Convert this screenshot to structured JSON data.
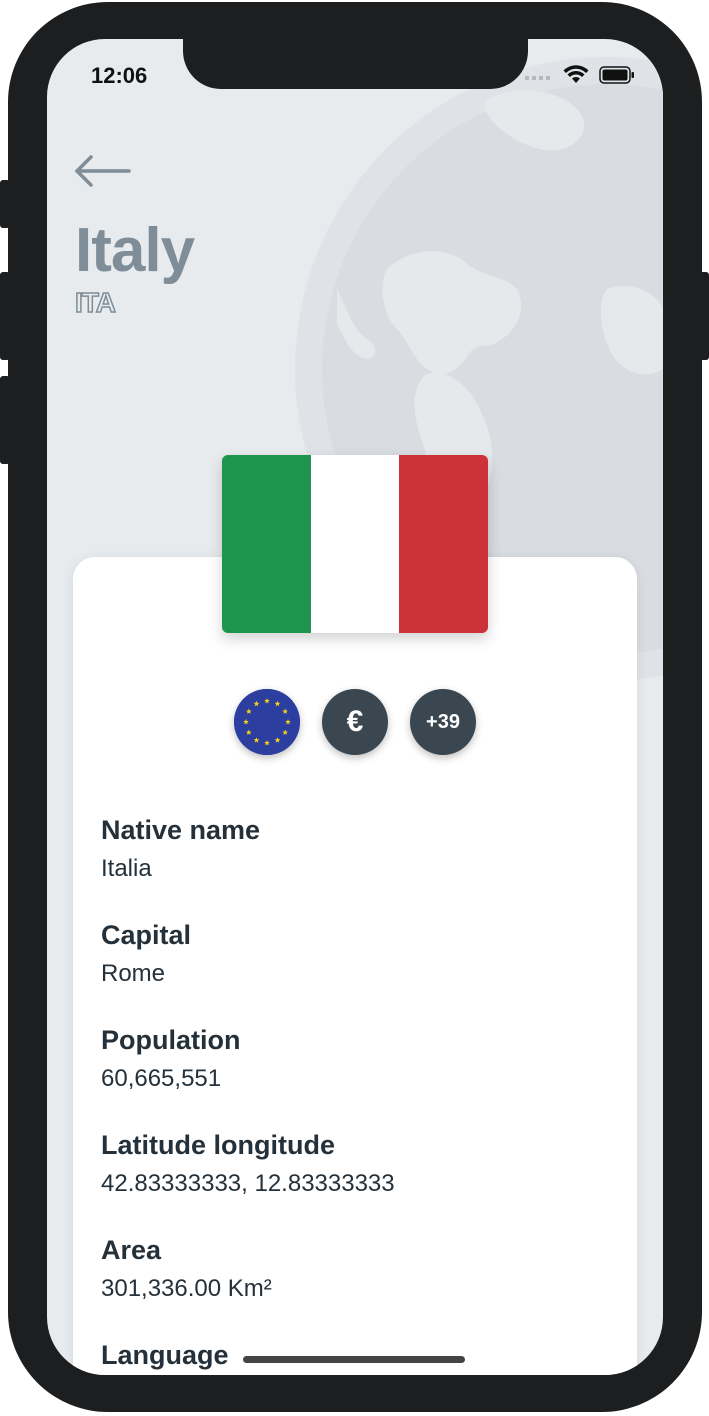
{
  "status": {
    "time": "12:06"
  },
  "country": {
    "name": "Italy",
    "code": "ITA"
  },
  "flag": {
    "colors": [
      "#1e944d",
      "#ffffff",
      "#cd313a"
    ]
  },
  "badges": [
    {
      "name": "european-union",
      "icon": "eu-flag-icon"
    },
    {
      "name": "currency",
      "text": "€"
    },
    {
      "name": "calling-code",
      "text": "+39"
    }
  ],
  "details": [
    {
      "label": "Native name",
      "value": "Italia"
    },
    {
      "label": "Capital",
      "value": "Rome"
    },
    {
      "label": "Population",
      "value": "60,665,551"
    },
    {
      "label": "Latitude longitude",
      "value": "42.83333333, 12.83333333"
    },
    {
      "label": "Area",
      "value": "301,336.00 Km²"
    },
    {
      "label": "Language",
      "value": ""
    }
  ],
  "colors": {
    "background": "#e8ebee",
    "title": "#7e8d97",
    "badge": "#3a4650",
    "text": "#25313a"
  }
}
